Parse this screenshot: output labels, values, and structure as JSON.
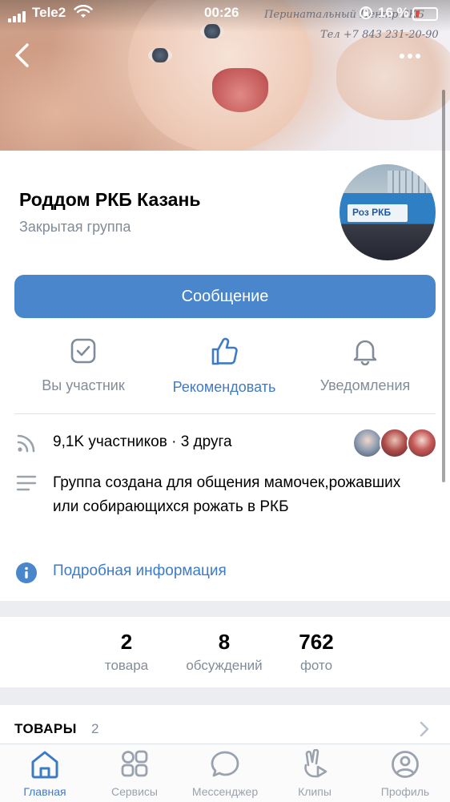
{
  "status_bar": {
    "carrier": "Tele2",
    "time": "00:26",
    "battery": "16 %"
  },
  "cover": {
    "watermark_line1": "Перинатальный Центр РКБ",
    "watermark_line2": "Тел +7 843 231-20-90"
  },
  "group": {
    "name": "Роддом РКБ Казань",
    "type": "Закрытая группа",
    "avatar_sign": "Роз  РКБ"
  },
  "message_button": "Сообщение",
  "actions": [
    {
      "label": "Вы участник",
      "icon": "checkbox-icon"
    },
    {
      "label": "Рекомендовать",
      "icon": "thumbs-up-icon"
    },
    {
      "label": "Уведомления",
      "icon": "bell-icon"
    }
  ],
  "members": {
    "text": "9,1K участников · 3 друга",
    "icon": "rss-icon"
  },
  "description": {
    "text": "Группа создана для общения мамочек,рожавших или собирающихся рожать в РКБ",
    "icon": "text-lines-icon"
  },
  "details_link": {
    "text": "Подробная информация",
    "icon": "info-icon"
  },
  "counters": [
    {
      "value": "2",
      "caption": "товара"
    },
    {
      "value": "8",
      "caption": "обсуждений"
    },
    {
      "value": "762",
      "caption": "фото"
    }
  ],
  "goods_section": {
    "title": "ТОВАРЫ",
    "count": "2"
  },
  "tabs": [
    {
      "label": "Главная",
      "icon": "home-icon",
      "active": true
    },
    {
      "label": "Сервисы",
      "icon": "services-grid-icon",
      "active": false
    },
    {
      "label": "Мессенджер",
      "icon": "chat-bubble-icon",
      "active": false
    },
    {
      "label": "Клипы",
      "icon": "clips-icon",
      "active": false
    },
    {
      "label": "Профиль",
      "icon": "profile-icon",
      "active": false
    }
  ],
  "colors": {
    "accent": "#4986cc",
    "link": "#3f7bc5",
    "secondary_text": "#818c99",
    "separator": "#ebedf0"
  }
}
